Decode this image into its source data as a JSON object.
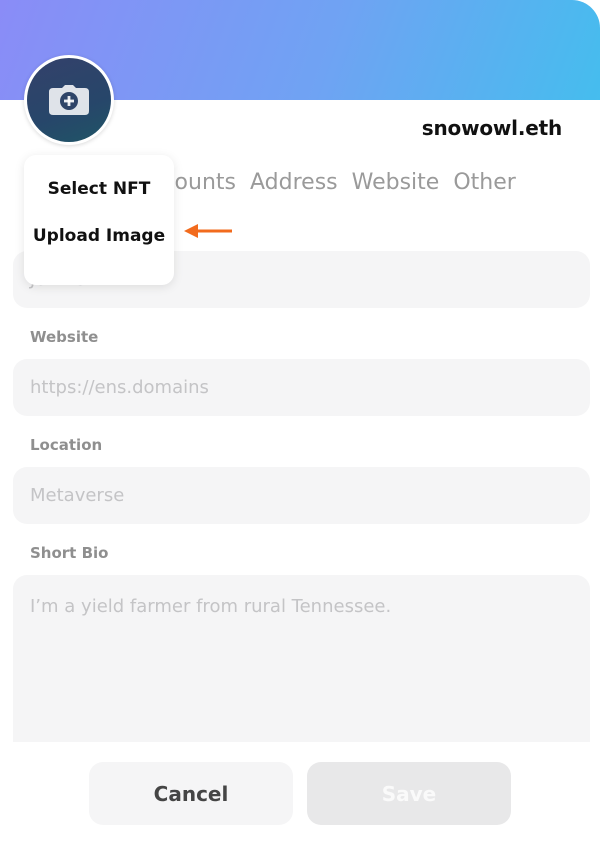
{
  "profile": {
    "name": "snowowl.eth"
  },
  "tabs": [
    "Accounts",
    "Address",
    "Website",
    "Other"
  ],
  "avatar_menu": {
    "select_nft": "Select NFT",
    "upload_image": "Upload Image"
  },
  "form": {
    "name_placeholder": "John Smith",
    "website_label": "Website",
    "website_placeholder": "https://ens.domains",
    "location_label": "Location",
    "location_placeholder": "Metaverse",
    "bio_label": "Short Bio",
    "bio_placeholder": "I’m a yield farmer from rural Tennessee."
  },
  "buttons": {
    "cancel": "Cancel",
    "save": "Save"
  },
  "colors": {
    "accent_arrow": "#f26b1d",
    "banner_start": "#8a8cf7",
    "banner_end": "#45bdee"
  },
  "icons": {
    "avatar": "camera-add-icon",
    "pointer": "arrow-left-icon"
  }
}
